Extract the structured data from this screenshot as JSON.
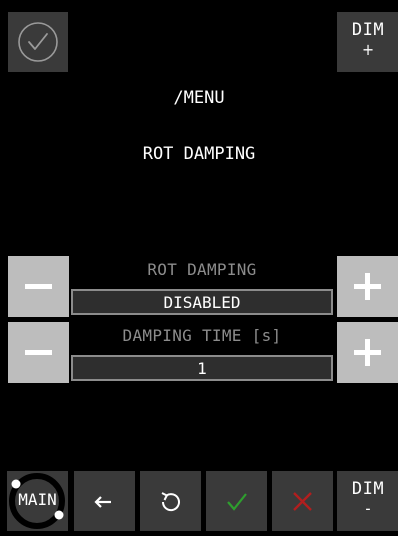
{
  "header": {
    "dim_up_label": "DIM",
    "dim_up_sign": "+",
    "menu_path": "/MENU",
    "page_title": "ROT DAMPING"
  },
  "params": [
    {
      "label": "ROT DAMPING",
      "value": "DISABLED"
    },
    {
      "label": "DAMPING TIME [s]",
      "value": "1"
    }
  ],
  "footer": {
    "main_label": "MAIN",
    "dim_down_label": "DIM",
    "dim_down_sign": "-"
  },
  "colors": {
    "background": "#000000",
    "tile": "#3a3a3a",
    "stepper": "#bdbdbd",
    "label_dim": "#8c8c8c",
    "ok_green": "#2e9e2e",
    "cancel_red": "#b21e1e"
  },
  "icons": [
    "check-circle-icon",
    "plus-icon",
    "minus-icon",
    "arrow-left-icon",
    "reset-icon",
    "check-icon",
    "close-icon"
  ]
}
